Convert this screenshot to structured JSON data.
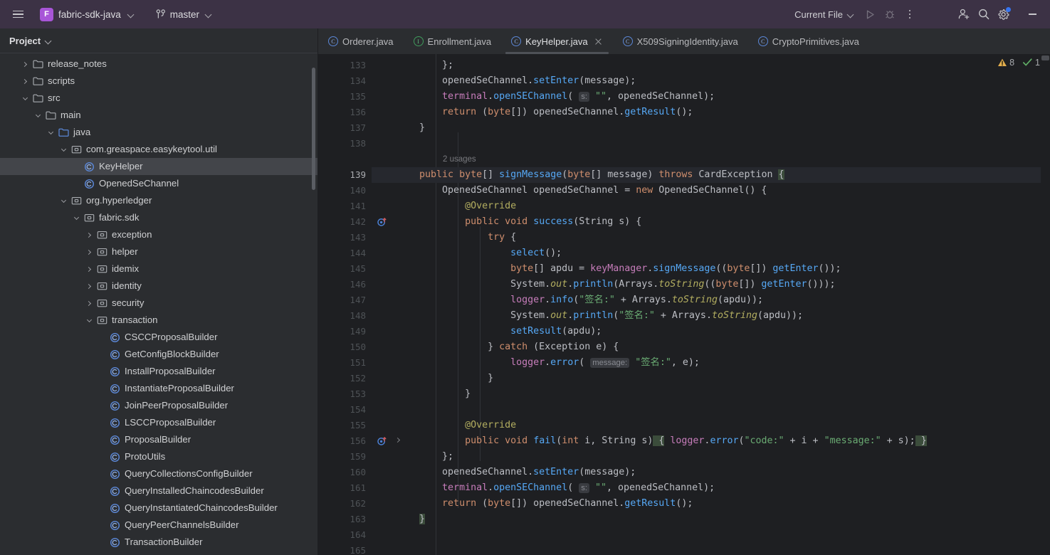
{
  "titlebar": {
    "menu_icon": "hamburger-icon",
    "project_badge": "F",
    "project_name": "fabric-sdk-java",
    "branch_icon": "git-branch-icon",
    "branch_name": "master",
    "run_config": "Current File",
    "run_icon": "run-icon",
    "debug_icon": "debug-icon",
    "more_icon": "more-vertical-icon",
    "account_icon": "add-user-icon",
    "search_icon": "search-icon",
    "settings_icon": "gear-icon",
    "minimize_icon": "minimize-icon"
  },
  "sidebar": {
    "title": "Project",
    "items": [
      {
        "label": "release_notes",
        "icon": "folder-icon",
        "depth": 1,
        "arrow": "collapsed",
        "selected": false
      },
      {
        "label": "scripts",
        "icon": "folder-icon",
        "depth": 1,
        "arrow": "collapsed",
        "selected": false
      },
      {
        "label": "src",
        "icon": "folder-icon",
        "depth": 1,
        "arrow": "expanded",
        "selected": false
      },
      {
        "label": "main",
        "icon": "folder-icon",
        "depth": 2,
        "arrow": "expanded",
        "selected": false
      },
      {
        "label": "java",
        "icon": "source-root-icon",
        "depth": 3,
        "arrow": "expanded",
        "selected": false
      },
      {
        "label": "com.greaspace.easykeytool.util",
        "icon": "package-icon",
        "depth": 4,
        "arrow": "expanded",
        "selected": false
      },
      {
        "label": "KeyHelper",
        "icon": "class-icon",
        "depth": 5,
        "arrow": "none",
        "selected": true
      },
      {
        "label": "OpenedSeChannel",
        "icon": "class-icon",
        "depth": 5,
        "arrow": "none",
        "selected": false
      },
      {
        "label": "org.hyperledger",
        "icon": "package-icon",
        "depth": 4,
        "arrow": "expanded",
        "selected": false
      },
      {
        "label": "fabric.sdk",
        "icon": "package-icon",
        "depth": 5,
        "arrow": "expanded",
        "selected": false
      },
      {
        "label": "exception",
        "icon": "package-icon",
        "depth": 6,
        "arrow": "collapsed",
        "selected": false
      },
      {
        "label": "helper",
        "icon": "package-icon",
        "depth": 6,
        "arrow": "collapsed",
        "selected": false
      },
      {
        "label": "idemix",
        "icon": "package-icon",
        "depth": 6,
        "arrow": "collapsed",
        "selected": false
      },
      {
        "label": "identity",
        "icon": "package-icon",
        "depth": 6,
        "arrow": "collapsed",
        "selected": false
      },
      {
        "label": "security",
        "icon": "package-icon",
        "depth": 6,
        "arrow": "collapsed",
        "selected": false
      },
      {
        "label": "transaction",
        "icon": "package-icon",
        "depth": 6,
        "arrow": "expanded",
        "selected": false
      },
      {
        "label": "CSCCProposalBuilder",
        "icon": "class-icon",
        "depth": 7,
        "arrow": "none",
        "selected": false
      },
      {
        "label": "GetConfigBlockBuilder",
        "icon": "class-icon",
        "depth": 7,
        "arrow": "none",
        "selected": false
      },
      {
        "label": "InstallProposalBuilder",
        "icon": "class-icon",
        "depth": 7,
        "arrow": "none",
        "selected": false
      },
      {
        "label": "InstantiateProposalBuilder",
        "icon": "class-icon",
        "depth": 7,
        "arrow": "none",
        "selected": false
      },
      {
        "label": "JoinPeerProposalBuilder",
        "icon": "class-icon",
        "depth": 7,
        "arrow": "none",
        "selected": false
      },
      {
        "label": "LSCCProposalBuilder",
        "icon": "class-icon",
        "depth": 7,
        "arrow": "none",
        "selected": false
      },
      {
        "label": "ProposalBuilder",
        "icon": "class-icon",
        "depth": 7,
        "arrow": "none",
        "selected": false
      },
      {
        "label": "ProtoUtils",
        "icon": "class-icon",
        "depth": 7,
        "arrow": "none",
        "selected": false
      },
      {
        "label": "QueryCollectionsConfigBuilder",
        "icon": "class-icon",
        "depth": 7,
        "arrow": "none",
        "selected": false
      },
      {
        "label": "QueryInstalledChaincodesBuilder",
        "icon": "class-icon",
        "depth": 7,
        "arrow": "none",
        "selected": false
      },
      {
        "label": "QueryInstantiatedChaincodesBuilder",
        "icon": "class-icon",
        "depth": 7,
        "arrow": "none",
        "selected": false
      },
      {
        "label": "QueryPeerChannelsBuilder",
        "icon": "class-icon",
        "depth": 7,
        "arrow": "none",
        "selected": false
      },
      {
        "label": "TransactionBuilder",
        "icon": "class-icon",
        "depth": 7,
        "arrow": "none",
        "selected": false
      }
    ]
  },
  "tabs": [
    {
      "label": "Orderer.java",
      "icon": "class-icon",
      "active": false,
      "closable": false
    },
    {
      "label": "Enrollment.java",
      "icon": "interface-icon",
      "active": false,
      "closable": false
    },
    {
      "label": "KeyHelper.java",
      "icon": "class-icon",
      "active": true,
      "closable": true
    },
    {
      "label": "X509SigningIdentity.java",
      "icon": "class-icon",
      "active": false,
      "closable": false
    },
    {
      "label": "CryptoPrimitives.java",
      "icon": "class-icon",
      "active": false,
      "closable": false
    }
  ],
  "inspection": {
    "warning_icon": "warning-triangle-icon",
    "warning_count": "8",
    "ok_icon": "check-icon",
    "ok_count": "1"
  },
  "editor": {
    "usage_hint": "2 usages",
    "lines": [
      {
        "num": "133",
        "cur": false,
        "mark": null
      },
      {
        "num": "134",
        "cur": false,
        "mark": null
      },
      {
        "num": "135",
        "cur": false,
        "mark": null
      },
      {
        "num": "136",
        "cur": false,
        "mark": null
      },
      {
        "num": "137",
        "cur": false,
        "mark": null
      },
      {
        "num": "138",
        "cur": false,
        "mark": null
      },
      {
        "num": "",
        "cur": false,
        "mark": null
      },
      {
        "num": "139",
        "cur": true,
        "mark": null
      },
      {
        "num": "140",
        "cur": false,
        "mark": null
      },
      {
        "num": "141",
        "cur": false,
        "mark": null
      },
      {
        "num": "142",
        "cur": false,
        "mark": "override-icon"
      },
      {
        "num": "143",
        "cur": false,
        "mark": null
      },
      {
        "num": "144",
        "cur": false,
        "mark": null
      },
      {
        "num": "145",
        "cur": false,
        "mark": null
      },
      {
        "num": "146",
        "cur": false,
        "mark": null
      },
      {
        "num": "147",
        "cur": false,
        "mark": null
      },
      {
        "num": "148",
        "cur": false,
        "mark": null
      },
      {
        "num": "149",
        "cur": false,
        "mark": null
      },
      {
        "num": "150",
        "cur": false,
        "mark": null
      },
      {
        "num": "151",
        "cur": false,
        "mark": null
      },
      {
        "num": "152",
        "cur": false,
        "mark": null
      },
      {
        "num": "153",
        "cur": false,
        "mark": null
      },
      {
        "num": "154",
        "cur": false,
        "mark": null
      },
      {
        "num": "155",
        "cur": false,
        "mark": null
      },
      {
        "num": "156",
        "cur": false,
        "mark": "override-icon",
        "fold": true
      },
      {
        "num": "159",
        "cur": false,
        "mark": null
      },
      {
        "num": "160",
        "cur": false,
        "mark": null
      },
      {
        "num": "161",
        "cur": false,
        "mark": null
      },
      {
        "num": "162",
        "cur": false,
        "mark": null
      },
      {
        "num": "163",
        "cur": false,
        "mark": null
      },
      {
        "num": "164",
        "cur": false,
        "mark": null
      },
      {
        "num": "165",
        "cur": false,
        "mark": null
      }
    ],
    "source_text": [
      "        };",
      "        openedSeChannel.setEnter(message);",
      "        terminal.openSEChannel( s: \"\", openedSeChannel);",
      "        return (byte[]) openedSeChannel.getResult();",
      "    }",
      "",
      "    2 usages",
      "    public byte[] signMessage(byte[] message) throws CardException {",
      "        OpenedSeChannel openedSeChannel = new OpenedSeChannel() {",
      "            @Override",
      "            public void success(String s) {",
      "                try {",
      "                    select();",
      "                    byte[] apdu = keyManager.signMessage((byte[]) getEnter());",
      "                    System.out.println(Arrays.toString((byte[]) getEnter()));",
      "                    logger.info(\"签名:\" + Arrays.toString(apdu));",
      "                    System.out.println(\"签名:\" + Arrays.toString(apdu));",
      "                    setResult(apdu);",
      "                } catch (Exception e) {",
      "                    logger.error( message: \"签名:\", e);",
      "                }",
      "            }",
      "",
      "            @Override",
      "            public void fail(int i, String s) { logger.error(\"code:\" + i + \"message:\" + s); }",
      "        };",
      "        openedSeChannel.setEnter(message);",
      "        terminal.openSEChannel( s: \"\", openedSeChannel);",
      "        return (byte[]) openedSeChannel.getResult();",
      "    }",
      "",
      ""
    ]
  },
  "colors": {
    "titlebar_bg": "#3c3245",
    "sidebar_bg": "#2b2d30",
    "editor_bg": "#1e1f22",
    "current_line_bg": "#26282e",
    "accent_purple": "#a855d8",
    "accent_blue": "#3574f0",
    "keyword": "#cf8e6d",
    "method": "#56a8f5",
    "string": "#6aab73",
    "field": "#c77dbb",
    "annotation": "#b3ae60",
    "warning": "#e3ae4d",
    "ok": "#5fad65"
  }
}
